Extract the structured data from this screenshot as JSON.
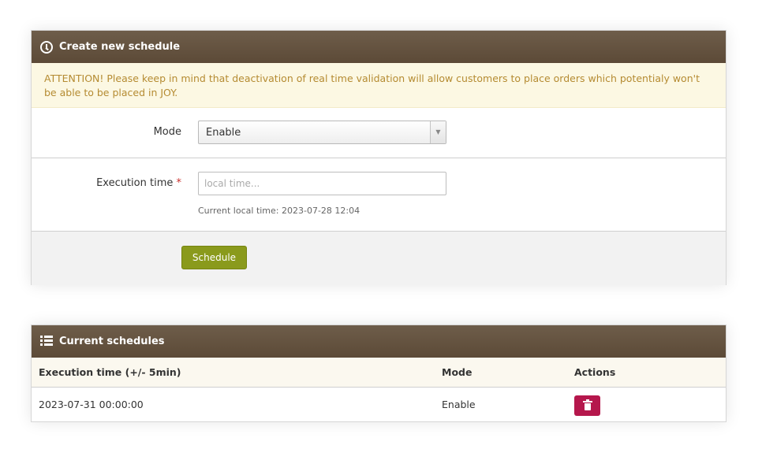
{
  "create_panel": {
    "title": "Create new schedule",
    "icon": "clock-icon",
    "alert": "ATTENTION! Please keep in mind that deactivation of real time validation will allow customers to place orders which potentialy won't be able to be placed in JOY.",
    "mode": {
      "label": "Mode",
      "selected": "Enable"
    },
    "execution_time": {
      "label": "Execution time",
      "required_mark": "*",
      "placeholder": "local time...",
      "value": "",
      "help": "Current local time: 2023-07-28 12:04"
    },
    "submit_label": "Schedule",
    "submit_color": "#8a9a1c",
    "header_color": "#5c4a37"
  },
  "current_panel": {
    "title": "Current schedules",
    "icon": "list-icon",
    "columns": [
      "Execution time (+/- 5min)",
      "Mode",
      "Actions"
    ],
    "rows": [
      {
        "execution_time": "2023-07-31 00:00:00",
        "mode": "Enable",
        "action_icon": "trash-icon",
        "action_color": "#b5174c"
      }
    ]
  }
}
